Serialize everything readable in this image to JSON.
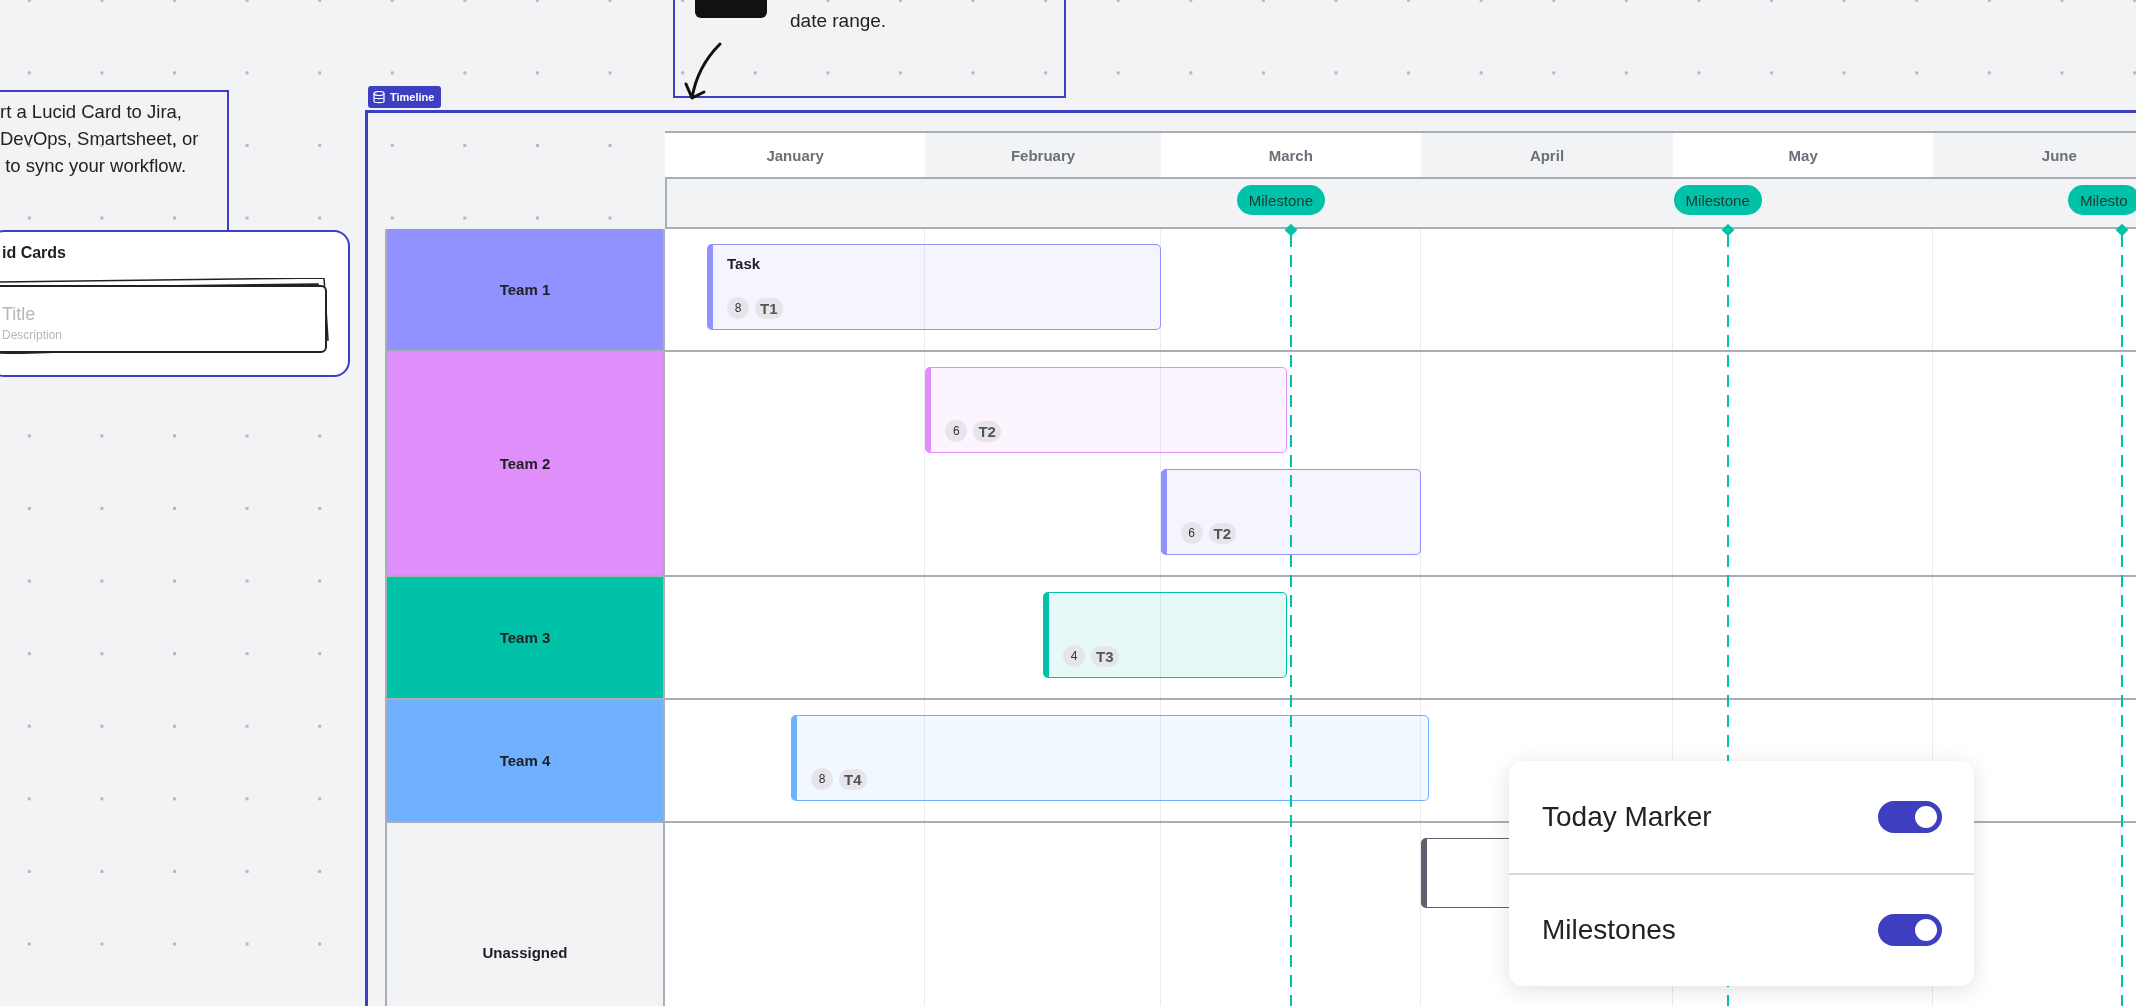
{
  "top_callout": {
    "text": "date range."
  },
  "left_callout": {
    "lines": [
      "rt a Lucid Card to Jira,",
      "DevOps, Smartsheet, or",
      " to sync your workflow."
    ]
  },
  "cards_panel": {
    "title": "id Cards",
    "card": {
      "title": "Title",
      "description": "Description"
    }
  },
  "timeline": {
    "label": "Timeline",
    "months": [
      "January",
      "February",
      "March",
      "April",
      "May",
      "June"
    ],
    "milestones": [
      {
        "label": "Milestone"
      },
      {
        "label": "Milestone"
      },
      {
        "label": "Milesto"
      }
    ],
    "teams": [
      {
        "name": "Team 1",
        "color": "#9191ff",
        "tasks": [
          {
            "title": "Task",
            "points": "8",
            "key": "T1",
            "color": "#9191ff"
          }
        ]
      },
      {
        "name": "Team 2",
        "color": "#e08ef9",
        "tasks": [
          {
            "points": "6",
            "key": "T2",
            "color": "#e08ef9"
          },
          {
            "points": "6",
            "key": "T2",
            "color": "#9191ff"
          }
        ]
      },
      {
        "name": "Team 3",
        "color": "#00c2a8",
        "tasks": [
          {
            "points": "4",
            "key": "T3",
            "color": "#00c2a8"
          }
        ]
      },
      {
        "name": "Team 4",
        "color": "#6fb0ff",
        "tasks": [
          {
            "points": "8",
            "key": "T4",
            "color": "#6fb0ff"
          }
        ]
      },
      {
        "name": "Unassigned",
        "color": "#f2f3f5",
        "tasks": [
          {
            "color": "#5f6370"
          }
        ]
      }
    ]
  },
  "popup": {
    "toggles": [
      {
        "label": "Today Marker",
        "on": true
      },
      {
        "label": "Milestones",
        "on": true
      }
    ]
  }
}
